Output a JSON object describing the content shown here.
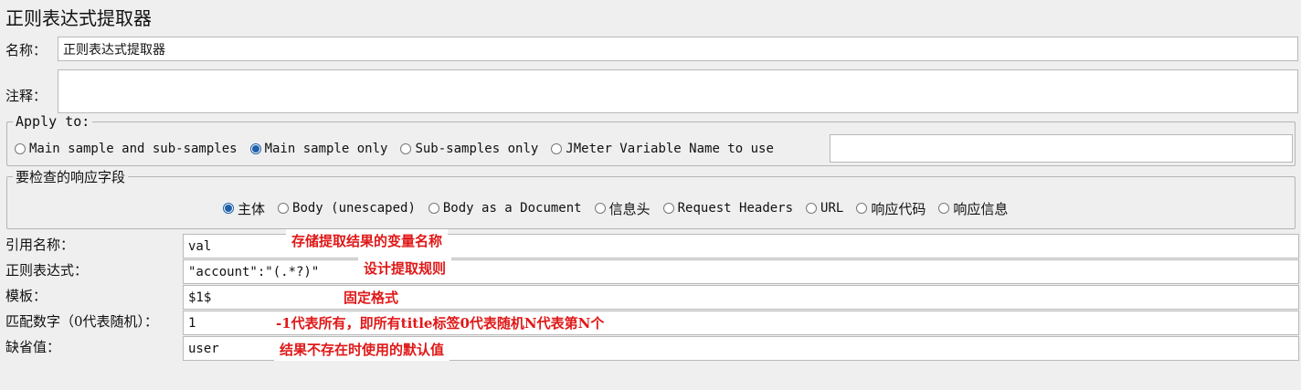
{
  "panel": {
    "title": "正则表达式提取器"
  },
  "name_row": {
    "label": "名称：",
    "value": "正则表达式提取器"
  },
  "comment_row": {
    "label": "注释：",
    "value": ""
  },
  "apply_to": {
    "legend": "Apply to:",
    "options": [
      {
        "label": "Main sample and sub-samples",
        "selected": false
      },
      {
        "label": "Main sample only",
        "selected": true
      },
      {
        "label": "Sub-samples only",
        "selected": false
      },
      {
        "label": "JMeter Variable Name to use",
        "selected": false
      }
    ],
    "variable_value": ""
  },
  "field_to_check": {
    "legend": "要检查的响应字段",
    "options": [
      {
        "label": "主体",
        "selected": true
      },
      {
        "label": "Body (unescaped)",
        "selected": false
      },
      {
        "label": "Body as a Document",
        "selected": false
      },
      {
        "label": "信息头",
        "selected": false
      },
      {
        "label": "Request Headers",
        "selected": false
      },
      {
        "label": "URL",
        "selected": false
      },
      {
        "label": "响应代码",
        "selected": false
      },
      {
        "label": "响应信息",
        "selected": false
      }
    ]
  },
  "fields": [
    {
      "label": "引用名称：",
      "value": "val"
    },
    {
      "label": "正则表达式：",
      "value": "\"account\":\"(.*?)\""
    },
    {
      "label": "模板：",
      "value": "$1$"
    },
    {
      "label": "匹配数字（0代表随机）：",
      "value": "1"
    },
    {
      "label": "缺省值：",
      "value": "user"
    }
  ],
  "annotations": [
    "存储提取结果的变量名称",
    "设计提取规则",
    "固定格式",
    "-1代表所有，即所有title标签0代表随机N代表第N个",
    "结果不存在时使用的默认值"
  ],
  "colors": {
    "annotation": "#e01818",
    "radio_selected": "#1e5fa8",
    "background": "#efefef"
  }
}
